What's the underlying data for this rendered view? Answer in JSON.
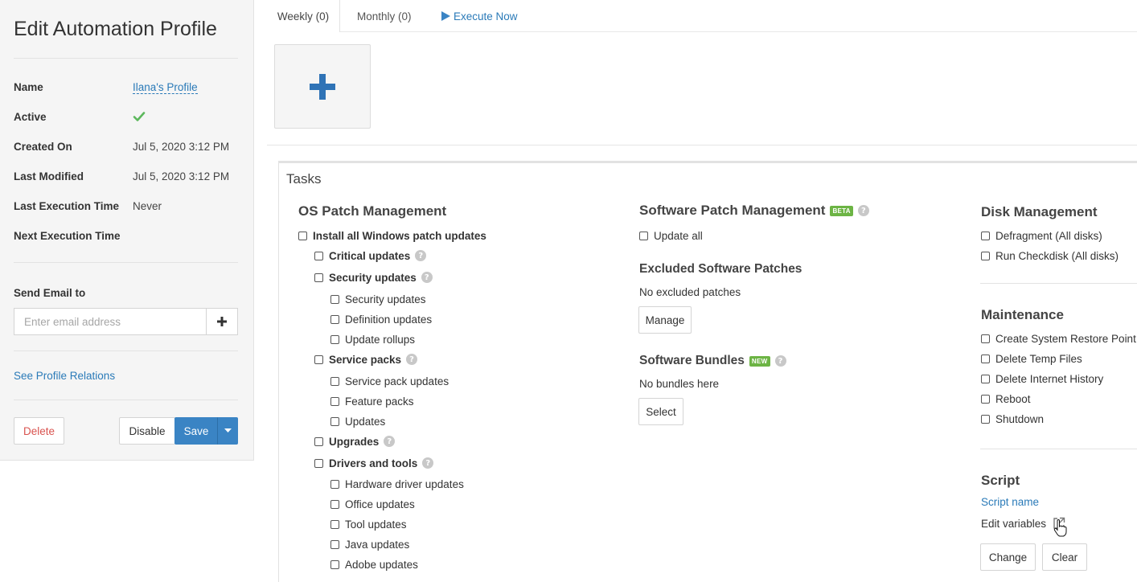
{
  "sidebar": {
    "title": "Edit Automation Profile",
    "fields": {
      "name_label": "Name",
      "name_value": "Ilana's Profile",
      "active_label": "Active",
      "active_value": "check",
      "created_label": "Created On",
      "created_value": "Jul 5, 2020 3:12 PM",
      "modified_label": "Last Modified",
      "modified_value": "Jul 5, 2020 3:12 PM",
      "last_exec_label": "Last Execution Time",
      "last_exec_value": "Never",
      "next_exec_label": "Next Execution Time"
    },
    "email": {
      "label": "Send Email to",
      "placeholder": "Enter email address",
      "value": ""
    },
    "relations_link": "See Profile Relations",
    "buttons": {
      "delete": "Delete",
      "disable": "Disable",
      "save": "Save"
    }
  },
  "tabs": [
    {
      "label": "Weekly (0)",
      "selected": true
    },
    {
      "label": "Monthly (0)",
      "selected": false
    },
    {
      "label": "Execute Now",
      "selected": false
    }
  ],
  "tasks": {
    "title": "Tasks",
    "os_patch": {
      "title": "OS Patch Management",
      "items": [
        {
          "label": "Install all Windows patch updates",
          "level": 0,
          "bold": true,
          "help": false
        },
        {
          "label": "Critical updates",
          "level": 1,
          "bold": true,
          "help": true
        },
        {
          "label": "Security updates",
          "level": 1,
          "bold": true,
          "help": true
        },
        {
          "label": "Security updates",
          "level": 2,
          "bold": false,
          "help": false
        },
        {
          "label": "Definition updates",
          "level": 2,
          "bold": false,
          "help": false
        },
        {
          "label": "Update rollups",
          "level": 2,
          "bold": false,
          "help": false
        },
        {
          "label": "Service packs",
          "level": 1,
          "bold": true,
          "help": true
        },
        {
          "label": "Service pack updates",
          "level": 2,
          "bold": false,
          "help": false
        },
        {
          "label": "Feature packs",
          "level": 2,
          "bold": false,
          "help": false
        },
        {
          "label": "Updates",
          "level": 2,
          "bold": false,
          "help": false
        },
        {
          "label": "Upgrades",
          "level": 1,
          "bold": true,
          "help": true
        },
        {
          "label": "Drivers and tools",
          "level": 1,
          "bold": true,
          "help": true
        },
        {
          "label": "Hardware driver updates",
          "level": 2,
          "bold": false,
          "help": false
        },
        {
          "label": "Office updates",
          "level": 2,
          "bold": false,
          "help": false
        },
        {
          "label": "Tool updates",
          "level": 2,
          "bold": false,
          "help": false
        },
        {
          "label": "Java updates",
          "level": 2,
          "bold": false,
          "help": false
        },
        {
          "label": "Adobe updates",
          "level": 2,
          "bold": false,
          "help": false
        }
      ]
    },
    "software_patch": {
      "title": "Software Patch Management",
      "badge": "BETA",
      "update_all": "Update all",
      "excluded_title": "Excluded Software Patches",
      "excluded_text": "No excluded patches",
      "manage_button": "Manage",
      "bundles_title": "Software Bundles",
      "bundles_badge": "NEW",
      "bundles_text": "No bundles here",
      "select_button": "Select"
    },
    "disk": {
      "title": "Disk Management",
      "items": [
        "Defragment (All disks)",
        "Run Checkdisk (All disks)"
      ]
    },
    "maintenance": {
      "title": "Maintenance",
      "items": [
        "Create System Restore Point",
        "Delete Temp Files",
        "Delete Internet History",
        "Reboot",
        "Shutdown"
      ]
    },
    "script": {
      "title": "Script",
      "name_link": "Script name",
      "edit_variables": "Edit variables",
      "change_button": "Change",
      "clear_button": "Clear"
    }
  },
  "colors": {
    "accent": "#3a84c4",
    "link": "#2a7ab8",
    "danger": "#d9534f",
    "success": "#5cb85c",
    "badge": "#6cb444"
  }
}
